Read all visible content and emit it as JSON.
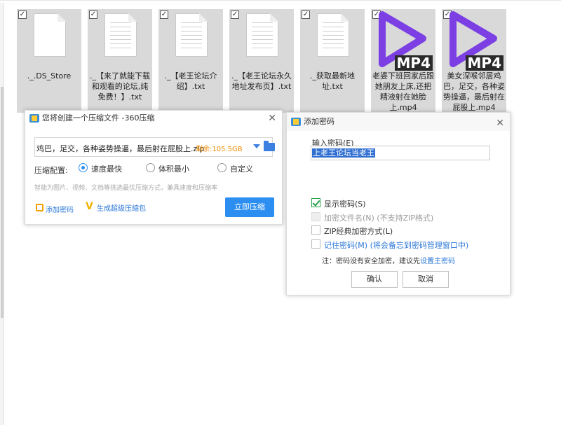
{
  "files": [
    {
      "name": "._.DS_Store",
      "type": "doc",
      "selected": true,
      "checked": true
    },
    {
      "name": "._【来了就能下载和观看的论坛,纯免费！】.txt",
      "type": "txt",
      "selected": true,
      "checked": true
    },
    {
      "name": "._【老王论坛介绍】.txt",
      "type": "txt",
      "selected": true,
      "checked": true
    },
    {
      "name": "._【老王论坛永久地址发布页】.txt",
      "type": "txt",
      "selected": true,
      "checked": true
    },
    {
      "name": "._获取最新地址.txt",
      "type": "txt",
      "selected": true,
      "checked": true
    },
    {
      "name": "老婆下班回家后跟她朋友上床,还把精液射在她脸上.mp4",
      "type": "mp4",
      "selected": true,
      "checked": true
    },
    {
      "name": "美女深喉邻居鸡巴，足交，各种姿势操逼，最后射在屁股上.mp4",
      "type": "mp4",
      "selected": true,
      "checked": true
    }
  ],
  "mp4_label": "MP4",
  "zip_dialog": {
    "title": "您将创建一个压缩文件 -360压缩",
    "path": "鸡巴，足交，各种姿势操逼，最后射在屁股上.zip",
    "free_space": "剩余:105.5GB",
    "mode_label": "压缩配置:",
    "modes": [
      {
        "label": "速度最快",
        "selected": true
      },
      {
        "label": "体积最小",
        "selected": false
      },
      {
        "label": "自定义",
        "selected": false
      }
    ],
    "hint": "智能为图片、视频、文档等挑选最优压缩方式，兼具速度和压缩率",
    "add_password": "添加密码",
    "super_zip": "生成超级压缩包",
    "compress_button": "立即压缩",
    "close": "✕"
  },
  "password_dialog": {
    "title": "添加密码",
    "close": "✕",
    "input_label": "输入密码(E)",
    "password_value": "上老王论坛当老王",
    "options": [
      {
        "label": "显示密码(S)",
        "checked": true,
        "disabled": false,
        "style": "normal"
      },
      {
        "label": "加密文件名(N) (不支持ZIP格式)",
        "checked": false,
        "disabled": true,
        "style": "disabled"
      },
      {
        "label": "ZIP经典加密方式(L)",
        "checked": false,
        "disabled": false,
        "style": "normal"
      },
      {
        "label": "记住密码(M) (将会备忘到密码管理窗口中)",
        "checked": false,
        "disabled": false,
        "style": "blue"
      }
    ],
    "note_prefix": "注：密码没有安全加密，建议先",
    "note_link": "设置主密码",
    "ok_button": "确认",
    "cancel_button": "取消"
  },
  "colors": {
    "accent": "#2c8ef0",
    "mp4_purple": "#7b3fe4",
    "free_space": "#f08c00",
    "selection": "#2f6fd1"
  }
}
